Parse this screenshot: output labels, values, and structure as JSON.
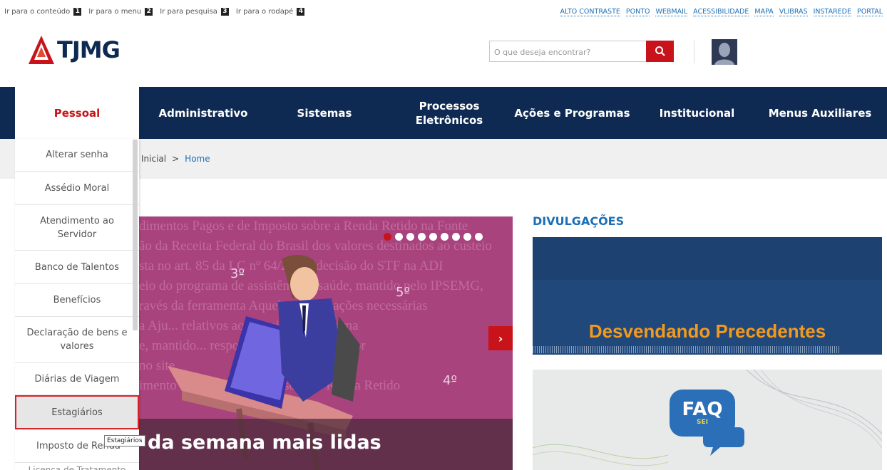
{
  "skip_links": [
    {
      "label": "Ir para o conteúdo",
      "num": "1"
    },
    {
      "label": "Ir para o menu",
      "num": "2"
    },
    {
      "label": "Ir para pesquisa",
      "num": "3"
    },
    {
      "label": "Ir para o rodapé",
      "num": "4"
    }
  ],
  "utility_links": [
    "ALTO CONTRASTE",
    "PONTO",
    "WEBMAIL",
    "ACESSIBILIDADE",
    "MAPA",
    "VLIBRAS",
    "INSTAREDE",
    "PORTAL"
  ],
  "logo": {
    "text": "TJMG"
  },
  "search": {
    "placeholder": "O que deseja encontrar?"
  },
  "nav": {
    "tabs": [
      "Pessoal",
      "Administrativo",
      "Sistemas",
      "Processos Eletrônicos",
      "Ações e Programas",
      "Institucional",
      "Menus Auxiliares"
    ],
    "active": "Pessoal"
  },
  "breadcrumb": {
    "inicial": "Inicial",
    "sep": ">",
    "home": "Home"
  },
  "dropdown": {
    "items": [
      "Alterar senha",
      "Assédio Moral",
      "Atendimento ao Servidor",
      "Banco de Talentos",
      "Benefícios",
      "Declaração de bens e valores",
      "Diárias de Viagem",
      "Estagiários",
      "Imposto de Renda"
    ],
    "highlighted": "Estagiários",
    "partial_last": "Licença de Tratamento"
  },
  "tooltip": "Estagiários",
  "banner": {
    "caption": "da semana mais lidas",
    "floor_labels": [
      "3º",
      "5º",
      "4º"
    ],
    "bg_lines": [
      "dimentos Pagos e de Imposto sobre a Renda Retido na Fonte",
      "ão da Receita Federal do Brasil dos valores destinados ao custeio",
      "sta no art. 85 da LC nº 64/2002 (decisão do STF na ADI",
      "eio do programa de assistência à saúde, mantido pelo IPSEMG,",
      "ravés da ferramenta Aqueles informações necessárias",
      "a Aju... relativos ao custeio do programa",
      "e, mantido... responsabilidade do servidor",
      "no site",
      "imento Pago e de Imposto sobre a Renda Retido"
    ],
    "dots": 9,
    "active_dot": 0,
    "next_label": "›"
  },
  "divulgacoes": {
    "title": "DIVULGAÇÕES",
    "card1_text": "Desvendando Precedentes",
    "card2_badge": "FAQ",
    "card2_sub": "SEI"
  },
  "colors": {
    "navy": "#0f2a52",
    "red": "#c8131a",
    "link": "#1a6fb5",
    "orange": "#f39a1e",
    "banner": "#a8437e"
  }
}
